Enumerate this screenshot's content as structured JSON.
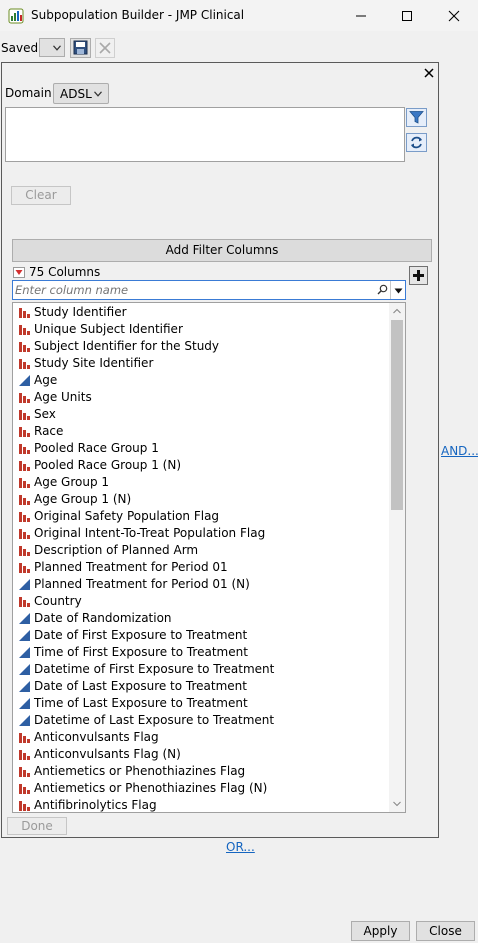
{
  "window": {
    "title": "Subpopulation Builder - JMP Clinical"
  },
  "saved": {
    "label": "Saved:"
  },
  "domain": {
    "label": "Domain:",
    "value": "ADSL"
  },
  "buttons": {
    "clear": "Clear",
    "add_filter_columns": "Add Filter Columns",
    "done": "Done",
    "apply": "Apply",
    "close": "Close"
  },
  "columns": {
    "count_label": "75 Columns"
  },
  "search": {
    "placeholder": "Enter column name"
  },
  "links": {
    "and": "AND...",
    "or": "OR..."
  },
  "colors": {
    "nominal": "#c0392b",
    "continuous": "#2e5fa3",
    "link": "#1565c0"
  },
  "column_items": [
    {
      "label": "Study Identifier",
      "icon": "nominal-bar-icon"
    },
    {
      "label": "Unique Subject Identifier",
      "icon": "nominal-bar-icon"
    },
    {
      "label": "Subject Identifier for the Study",
      "icon": "nominal-bar-icon"
    },
    {
      "label": "Study Site Identifier",
      "icon": "nominal-bar-icon"
    },
    {
      "label": "Age",
      "icon": "continuous-triangle-icon"
    },
    {
      "label": "Age Units",
      "icon": "nominal-bar-icon"
    },
    {
      "label": "Sex",
      "icon": "nominal-bar-icon"
    },
    {
      "label": "Race",
      "icon": "nominal-bar-icon"
    },
    {
      "label": "Pooled Race Group 1",
      "icon": "nominal-bar-icon"
    },
    {
      "label": "Pooled Race Group 1 (N)",
      "icon": "nominal-bar-icon"
    },
    {
      "label": "Age Group 1",
      "icon": "nominal-bar-icon"
    },
    {
      "label": "Age Group 1 (N)",
      "icon": "nominal-bar-icon"
    },
    {
      "label": "Original Safety Population Flag",
      "icon": "nominal-bar-icon"
    },
    {
      "label": "Original Intent-To-Treat Population Flag",
      "icon": "nominal-bar-icon"
    },
    {
      "label": "Description of Planned Arm",
      "icon": "nominal-bar-icon"
    },
    {
      "label": "Planned Treatment for Period 01",
      "icon": "nominal-bar-icon"
    },
    {
      "label": "Planned Treatment for Period 01 (N)",
      "icon": "continuous-triangle-icon"
    },
    {
      "label": "Country",
      "icon": "nominal-bar-icon"
    },
    {
      "label": "Date of Randomization",
      "icon": "continuous-triangle-icon"
    },
    {
      "label": "Date of First Exposure to Treatment",
      "icon": "continuous-triangle-icon"
    },
    {
      "label": "Time of First Exposure to Treatment",
      "icon": "continuous-triangle-icon"
    },
    {
      "label": "Datetime of First Exposure to Treatment",
      "icon": "continuous-triangle-icon"
    },
    {
      "label": "Date of Last Exposure to Treatment",
      "icon": "continuous-triangle-icon"
    },
    {
      "label": "Time of Last Exposure to Treatment",
      "icon": "continuous-triangle-icon"
    },
    {
      "label": "Datetime of Last Exposure to Treatment",
      "icon": "continuous-triangle-icon"
    },
    {
      "label": "Anticonvulsants Flag",
      "icon": "nominal-bar-icon"
    },
    {
      "label": "Anticonvulsants Flag (N)",
      "icon": "nominal-bar-icon"
    },
    {
      "label": "Antiemetics or Phenothiazines Flag",
      "icon": "nominal-bar-icon"
    },
    {
      "label": "Antiemetics or Phenothiazines Flag (N)",
      "icon": "nominal-bar-icon"
    },
    {
      "label": "Antifibrinolytics Flag",
      "icon": "nominal-bar-icon"
    }
  ]
}
